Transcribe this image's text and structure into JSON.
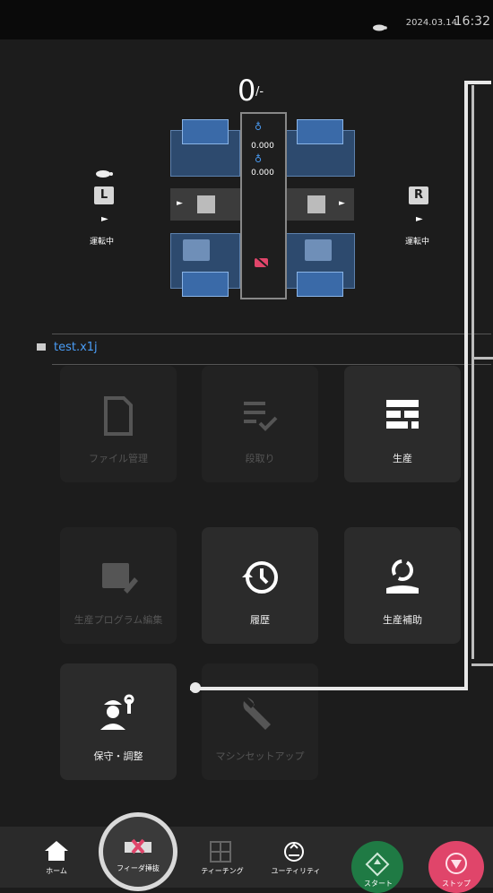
{
  "status": {
    "date": "2024.03.14",
    "time": "16:32"
  },
  "counter": {
    "value": "0",
    "unit": "/-"
  },
  "left_lane": {
    "label": "L",
    "arrow": "►",
    "state": "運転中"
  },
  "right_lane": {
    "label": "R",
    "arrow": "►",
    "state": "運転中"
  },
  "machine": {
    "value_top": "0.000",
    "value_bottom": "0.000"
  },
  "file": {
    "name": "test.x1j"
  },
  "tiles": [
    {
      "label": "ファイル管理",
      "enabled": false,
      "icon": "document-icon"
    },
    {
      "label": "段取り",
      "enabled": false,
      "icon": "list-check-icon"
    },
    {
      "label": "生産",
      "enabled": true,
      "icon": "panels-icon"
    },
    {
      "label": "生産プログラム編集",
      "enabled": false,
      "icon": "edit-program-icon"
    },
    {
      "label": "履歴",
      "enabled": true,
      "icon": "history-icon"
    },
    {
      "label": "生産補助",
      "enabled": true,
      "icon": "recycle-hand-icon"
    },
    {
      "label": "保守・調整",
      "enabled": true,
      "icon": "maintenance-worker-icon"
    },
    {
      "label": "マシンセットアップ",
      "enabled": false,
      "icon": "wrench-icon"
    }
  ],
  "nav": [
    {
      "label": "ホーム",
      "icon": "home-icon"
    },
    {
      "label": "フィーダ挿抜",
      "icon": "feeder-icon"
    },
    {
      "label": "ティーチング",
      "icon": "teaching-icon"
    },
    {
      "label": "ユーティリティ",
      "icon": "utility-icon"
    },
    {
      "label": "スタート",
      "icon": "start-icon"
    },
    {
      "label": "ストップ",
      "icon": "stop-icon"
    }
  ],
  "colors": {
    "accent": "#4a9cf5",
    "start": "#1f7a44",
    "stop": "#e0456a",
    "blue_tray": "#2d4a6e"
  }
}
